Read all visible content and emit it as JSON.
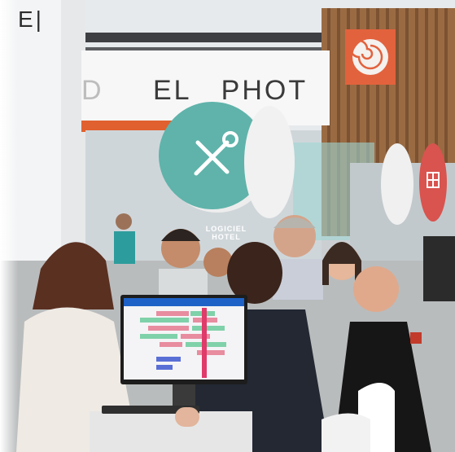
{
  "scene": {
    "description_colors": {
      "teal_sign": "#5fb3aa",
      "orange_banner": "#e2623d",
      "red_sign": "#d9534f",
      "wood_wall": "#9a6b43"
    },
    "icons": {
      "tools_sign": "wrench-screwdriver-icon",
      "orange_banner": "swirl-logo-icon",
      "red_sign": "grid-icon"
    }
  },
  "signage": {
    "top_left_sign": "E|",
    "banner_text": "EL   PHOT",
    "banner_prefix": "D",
    "booth_text_line1": "LOGICIEL",
    "booth_text_line2": "HOTEL"
  },
  "monitor": {
    "label": ""
  }
}
